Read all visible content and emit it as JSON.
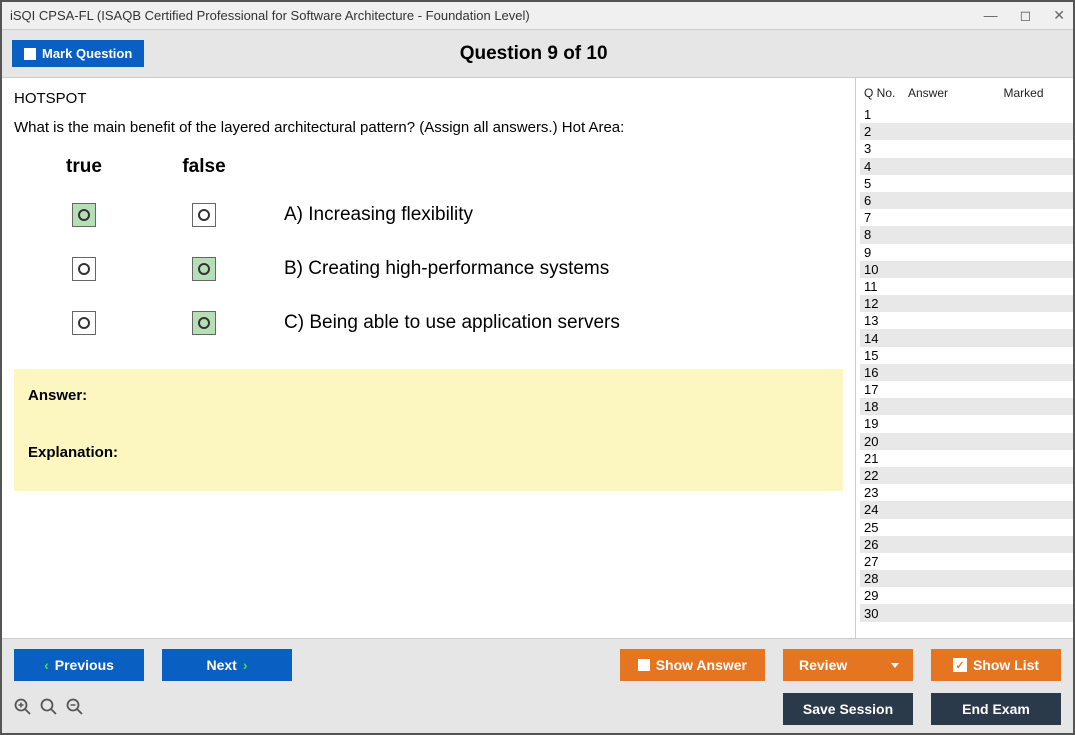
{
  "window": {
    "title": "iSQI CPSA-FL (ISAQB Certified Professional for Software Architecture - Foundation Level)"
  },
  "header": {
    "mark_label": "Mark Question",
    "question_title": "Question 9 of 10"
  },
  "question": {
    "type": "HOTSPOT",
    "text": "What is the main benefit of the layered architectural pattern? (Assign all answers.) Hot Area:",
    "headers": {
      "true": "true",
      "false": "false"
    },
    "options": [
      {
        "text": "A) Increasing flexibility",
        "true_sel": true,
        "false_sel": false
      },
      {
        "text": "B) Creating high-performance systems",
        "true_sel": false,
        "false_sel": true
      },
      {
        "text": "C) Being able to use application servers",
        "true_sel": false,
        "false_sel": true
      }
    ]
  },
  "answer_box": {
    "answer_label": "Answer:",
    "explanation_label": "Explanation:"
  },
  "side": {
    "headers": {
      "qno": "Q No.",
      "answer": "Answer",
      "marked": "Marked"
    },
    "rows": [
      1,
      2,
      3,
      4,
      5,
      6,
      7,
      8,
      9,
      10,
      11,
      12,
      13,
      14,
      15,
      16,
      17,
      18,
      19,
      20,
      21,
      22,
      23,
      24,
      25,
      26,
      27,
      28,
      29,
      30
    ]
  },
  "footer": {
    "previous": "Previous",
    "next": "Next",
    "show_answer": "Show Answer",
    "review": "Review",
    "show_list": "Show List",
    "save_session": "Save Session",
    "end_exam": "End Exam"
  }
}
